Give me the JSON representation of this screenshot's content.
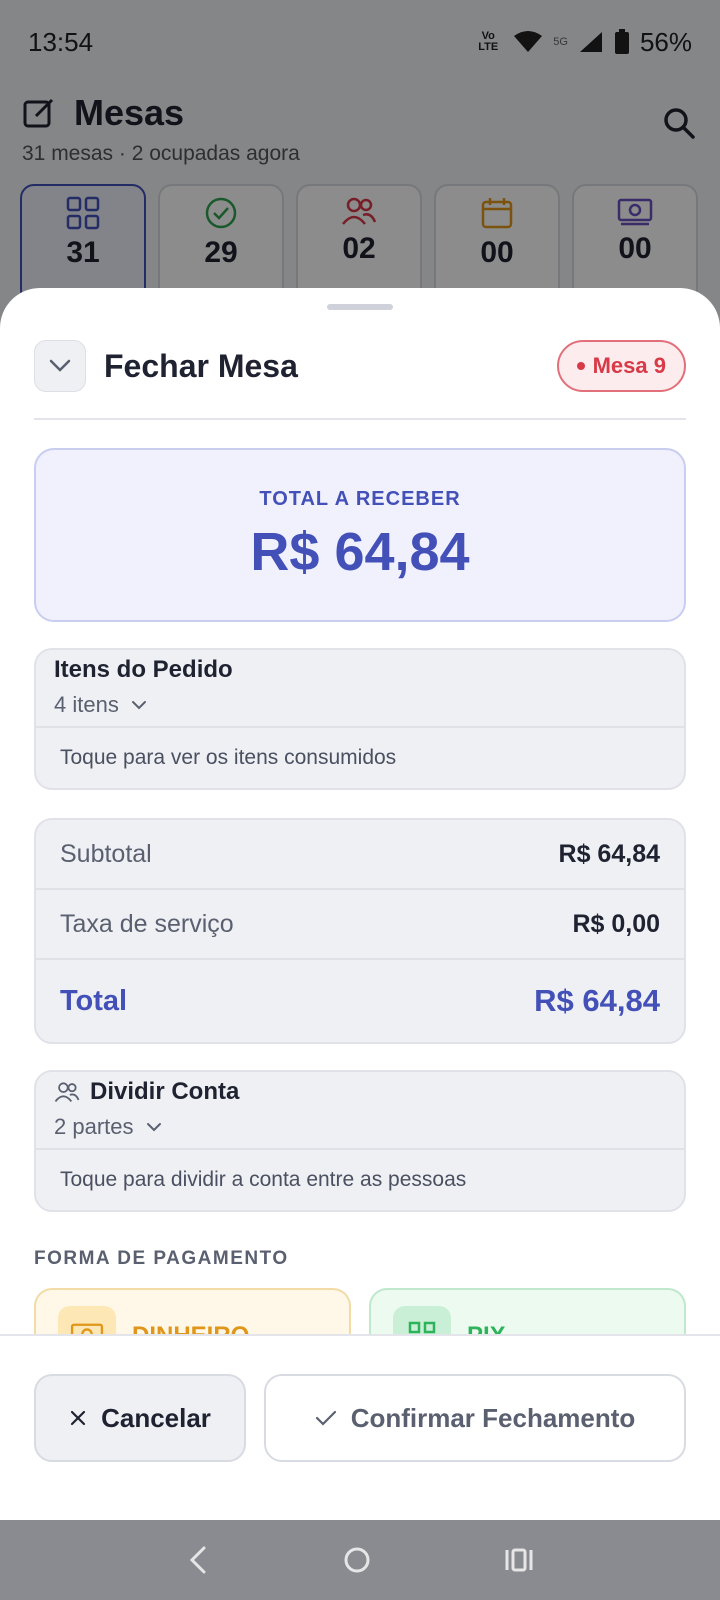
{
  "status_bar": {
    "time": "13:54",
    "volte": "Vo LTE",
    "network": "5G",
    "battery": "56%"
  },
  "background": {
    "title": "Mesas",
    "subtitle": "31 mesas · 2 ocupadas agora",
    "stats": [
      {
        "value": "31",
        "icon": "grid-icon",
        "color": "#4250b8"
      },
      {
        "value": "29",
        "icon": "check-circle-icon",
        "color": "#2fa24f"
      },
      {
        "value": "02",
        "icon": "people-icon",
        "color": "#d83a48"
      },
      {
        "value": "00",
        "icon": "calendar-icon",
        "color": "#e0961a"
      },
      {
        "value": "00",
        "icon": "money-icon",
        "color": "#6a4fc0"
      }
    ]
  },
  "sheet": {
    "title": "Fechar Mesa",
    "badge": "Mesa 9",
    "total_label": "TOTAL A RECEBER",
    "total_value": "R$ 64,84",
    "items": {
      "title": "Itens do Pedido",
      "count": "4 itens",
      "hint": "Toque para ver os itens consumidos"
    },
    "summary": {
      "subtotal_label": "Subtotal",
      "subtotal_value": "R$ 64,84",
      "service_label": "Taxa de serviço",
      "service_value": "R$ 0,00",
      "total_label": "Total",
      "total_value": "R$ 64,84"
    },
    "split": {
      "title": "Dividir Conta",
      "parts": "2 partes",
      "hint": "Toque para dividir a conta entre as pessoas"
    },
    "payment_label": "FORMA DE PAGAMENTO",
    "payment_methods": [
      {
        "label": "DINHEIRO",
        "icon": "cash-icon"
      },
      {
        "label": "PIX",
        "icon": "qr-code-icon"
      }
    ]
  },
  "footer": {
    "cancel_label": "Cancelar",
    "confirm_label": "Confirmar Fechamento"
  },
  "colors": {
    "accent": "#4250b8",
    "danger": "#d83a48",
    "cash": "#e0961a",
    "pix": "#2db35a"
  }
}
